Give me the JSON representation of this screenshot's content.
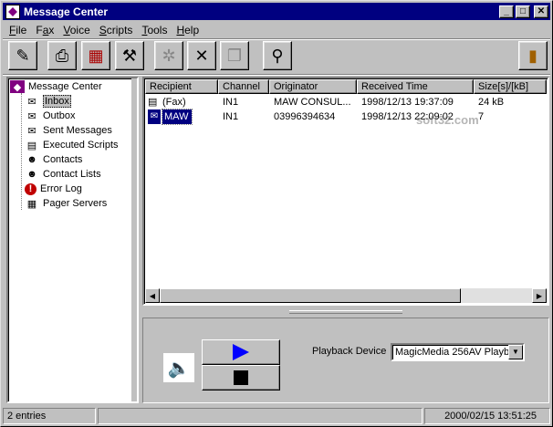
{
  "window": {
    "title": "Message Center"
  },
  "menu": [
    "File",
    "Fax",
    "Voice",
    "Scripts",
    "Tools",
    "Help"
  ],
  "menu_underline": [
    "F",
    "a",
    "V",
    "S",
    "T",
    "H"
  ],
  "toolbar": {
    "buttons": [
      {
        "icon": "compose-icon",
        "glyph": "✎"
      },
      {
        "icon": "fax-send-icon",
        "glyph": "⎙"
      },
      {
        "icon": "fax-receive-icon",
        "glyph": "▦"
      },
      {
        "icon": "tools-icon",
        "glyph": "⚒"
      },
      {
        "icon": "settings-icon",
        "glyph": "✲"
      },
      {
        "icon": "delete-icon",
        "glyph": "✕"
      },
      {
        "icon": "copy-icon",
        "glyph": "❐"
      },
      {
        "icon": "connect-icon",
        "glyph": "⚲"
      },
      {
        "icon": "exit-door-icon",
        "glyph": "▮"
      }
    ]
  },
  "tree": {
    "root": "Message Center",
    "items": [
      {
        "label": "Inbox",
        "icon": "inbox-icon",
        "glyph": "✉",
        "selected": true
      },
      {
        "label": "Outbox",
        "icon": "outbox-icon",
        "glyph": "✉"
      },
      {
        "label": "Sent Messages",
        "icon": "sent-icon",
        "glyph": "✉"
      },
      {
        "label": "Executed Scripts",
        "icon": "scripts-icon",
        "glyph": "▤"
      },
      {
        "label": "Contacts",
        "icon": "contact-icon",
        "glyph": "☻"
      },
      {
        "label": "Contact Lists",
        "icon": "contact-list-icon",
        "glyph": "☻"
      },
      {
        "label": "Error Log",
        "icon": "error-icon",
        "glyph": "!"
      },
      {
        "label": "Pager Servers",
        "icon": "pager-icon",
        "glyph": "▦"
      }
    ]
  },
  "list": {
    "columns": [
      "Recipient",
      "Channel",
      "Originator",
      "Received Time",
      "Size[s]/[kB]"
    ],
    "rows": [
      {
        "recipient": "(Fax)",
        "channel": "IN1",
        "originator": "MAW CONSUL...",
        "time": "1998/12/13  19:37:09",
        "size": "24 kB"
      },
      {
        "recipient": "MAW",
        "channel": "IN1",
        "originator": "03996394634",
        "time": "1998/12/13  22:09:02",
        "size": "7"
      }
    ]
  },
  "playback": {
    "label": "Playback Device",
    "device": "MagicMedia 256AV Playb"
  },
  "status": {
    "entries": "2 entries",
    "middle": "",
    "datetime": "2000/02/15 13:51:25"
  },
  "watermark": "soft32.com"
}
